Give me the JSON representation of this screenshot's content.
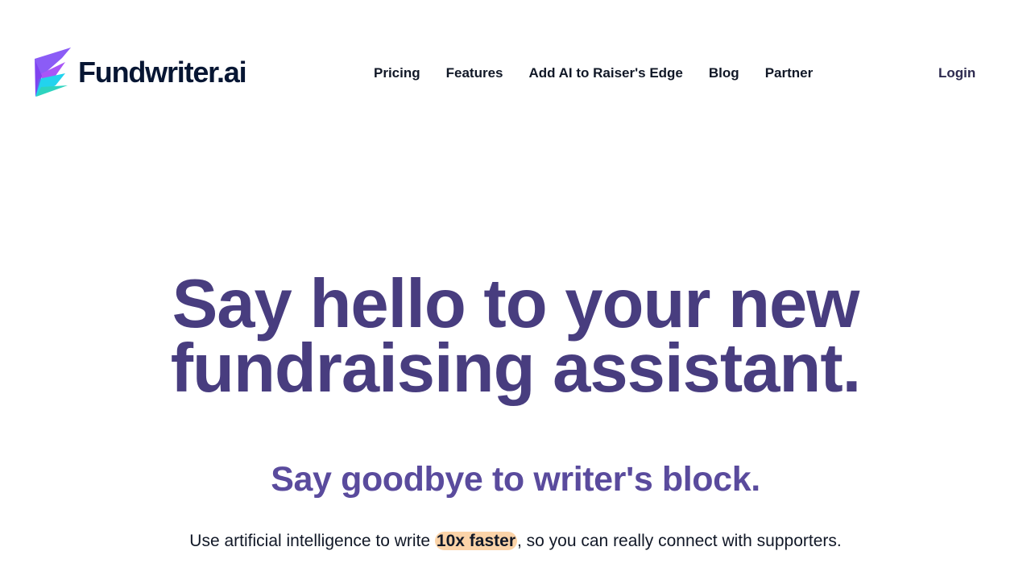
{
  "header": {
    "logo_text": "Fundwriter.ai",
    "logo_icon": "paper-plane-icon",
    "nav_items": [
      {
        "label": "Pricing"
      },
      {
        "label": "Features"
      },
      {
        "label": "Add AI to Raiser's Edge"
      },
      {
        "label": "Blog"
      },
      {
        "label": "Partner"
      }
    ],
    "login_label": "Login"
  },
  "hero": {
    "title_line_1": "Say hello to your new",
    "title_line_2": "fundraising assistant.",
    "subtitle": "Say goodbye to writer's block.",
    "description": {
      "before": "Use artificial intelligence to write ",
      "highlight": "10x faster",
      "after": ", so you can really connect with supporters."
    }
  },
  "colors": {
    "brand_navy": "#071633",
    "headline_purple": "#483d7f",
    "subtitle_purple": "#5a4b9d",
    "highlight_peach": "#fbd3a8",
    "logo_purple": "#8b5cf6",
    "logo_cyan": "#22d3ee"
  }
}
